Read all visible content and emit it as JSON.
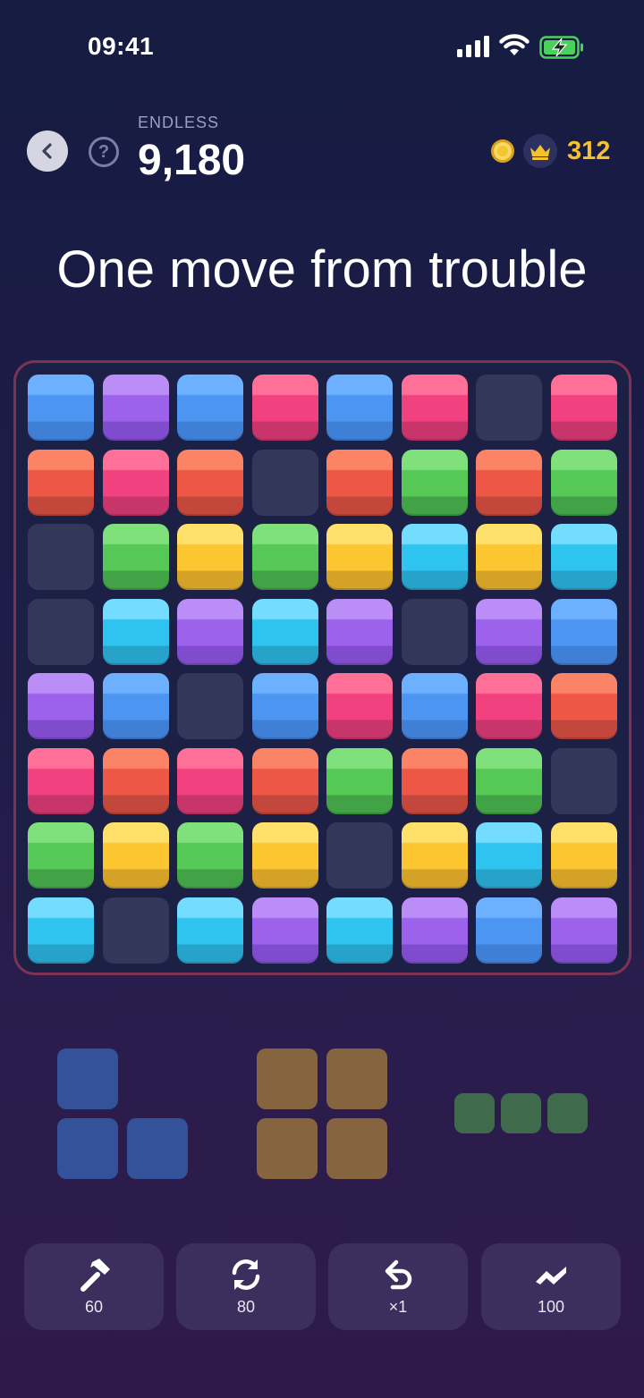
{
  "status_bar": {
    "time": "09:41"
  },
  "header": {
    "mode": "ENDLESS",
    "score": "9,180",
    "coins": "312"
  },
  "headline": "One move from trouble",
  "colors": {
    "blue": [
      "#6db0ff",
      "#4c96f2",
      "#3f7fd6"
    ],
    "purple": [
      "#bb8ef7",
      "#9d62ec",
      "#7f4cce"
    ],
    "pink": [
      "#ff7098",
      "#f2417f",
      "#c8356b"
    ],
    "red": [
      "#fb8466",
      "#ee5745",
      "#c4473b"
    ],
    "green": [
      "#7fe07c",
      "#55c856",
      "#41a345"
    ],
    "yellow": [
      "#ffe06a",
      "#fbc62f",
      "#d3a226"
    ],
    "cyan": [
      "#73dcff",
      "#2fc4f0",
      "#27a2c9"
    ],
    "empty": "#33385a"
  },
  "board": [
    [
      "blue",
      "purple",
      "blue",
      "pink",
      "blue",
      "pink",
      "empty",
      "pink"
    ],
    [
      "red",
      "pink",
      "red",
      "empty",
      "red",
      "green",
      "red",
      "green"
    ],
    [
      "empty",
      "green",
      "yellow",
      "green",
      "yellow",
      "cyan",
      "yellow",
      "cyan"
    ],
    [
      "empty",
      "cyan",
      "purple",
      "cyan",
      "purple",
      "empty",
      "purple",
      "blue"
    ],
    [
      "purple",
      "blue",
      "empty",
      "blue",
      "pink",
      "blue",
      "pink",
      "red"
    ],
    [
      "pink",
      "red",
      "pink",
      "red",
      "green",
      "red",
      "green",
      "empty"
    ],
    [
      "green",
      "yellow",
      "green",
      "yellow",
      "empty",
      "yellow",
      "cyan",
      "yellow"
    ],
    [
      "cyan",
      "empty",
      "cyan",
      "purple",
      "cyan",
      "purple",
      "blue",
      "purple"
    ]
  ],
  "pieces": [
    {
      "name": "l-piece",
      "color": "#33529a"
    },
    {
      "name": "square-piece",
      "color": "#86643f"
    },
    {
      "name": "line-piece",
      "color": "#3f6a4c"
    }
  ],
  "tools": [
    {
      "name": "hammer",
      "icon": "hammer-icon",
      "count": "60"
    },
    {
      "name": "shuffle",
      "icon": "refresh-icon",
      "count": "80"
    },
    {
      "name": "undo",
      "icon": "undo-icon",
      "count": "×1"
    },
    {
      "name": "bomb",
      "icon": "lightning-icon",
      "count": "100"
    }
  ]
}
